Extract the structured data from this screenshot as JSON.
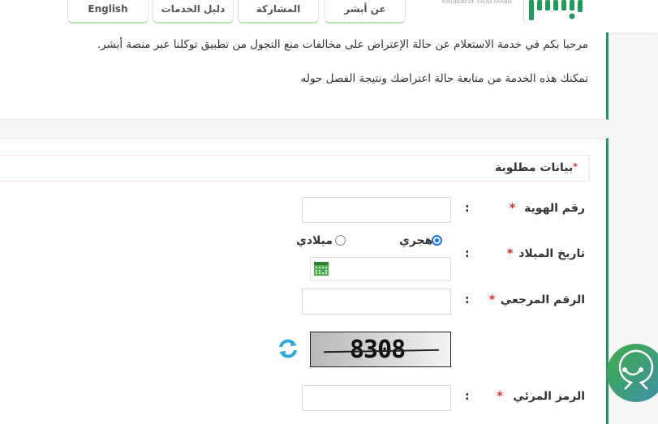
{
  "header": {
    "nav": [
      {
        "id": "about",
        "label": "عن أبشر"
      },
      {
        "id": "participation",
        "label": "المشاركة"
      },
      {
        "id": "services-guide",
        "label": "دليل الخدمات"
      },
      {
        "id": "english",
        "label": "English"
      }
    ],
    "kingdom_text": "KINGDOM OF SAUDI ARABIA",
    "logo_icon": "absher-logo",
    "brand_color": "#1e9a5b"
  },
  "intro": {
    "line1": "مرحبا بكم في خدمة الاستعلام عن حالة الإعتراض على مخالفات منع التجول من تطبيق توكلنا عبر منصة أبشر.",
    "line2": "تمكنك هذه الخدمة من متابعة حالة اعتراضك ونتيجة الفصل حوله"
  },
  "form": {
    "required_note": "بيانات مطلوبة",
    "required_star": "*",
    "colon": ":",
    "fields": {
      "id_number": {
        "label": "رقم الهوية",
        "value": "",
        "placeholder": ""
      },
      "birth_date": {
        "label": "تاريخ الميلاد",
        "value": "",
        "placeholder": "",
        "calendar_types": [
          {
            "label": "هجري",
            "selected": true
          },
          {
            "label": "ميلادي",
            "selected": false
          }
        ]
      },
      "reference_number": {
        "label": "الرقم المرجعي",
        "value": "",
        "placeholder": ""
      },
      "captcha": {
        "image_text": "8308",
        "refresh_icon": "refresh-icon"
      },
      "visual_code": {
        "label": "الرمز المرئي",
        "value": "",
        "placeholder": ""
      }
    }
  },
  "help_widget": {
    "icon": "chat-assistant-icon"
  }
}
